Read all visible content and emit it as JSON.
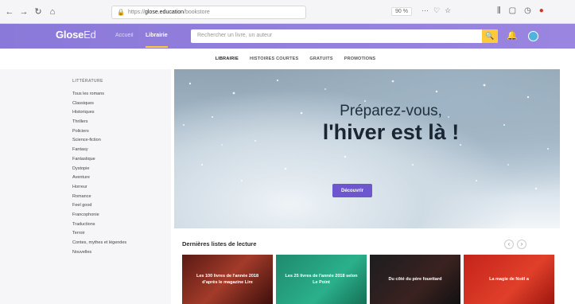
{
  "browser": {
    "nav_icons": [
      "←",
      "→",
      "↻",
      "⌂"
    ],
    "url_prefix": "https://",
    "url_host": "glose.education",
    "url_path": "/bookstore",
    "zoom": "90 %",
    "url_icons": [
      "···",
      "♡",
      "☆"
    ],
    "toolbar_icons": [
      "lib-icon",
      "sidebar-icon",
      "history-icon",
      "record-icon"
    ]
  },
  "header": {
    "logo_main": "Glose",
    "logo_suffix": "Ed",
    "nav_accueil": "Accueil",
    "nav_librairie": "Librairie",
    "search_placeholder": "Rechercher un livre, un auteur",
    "search_icon": "🔍",
    "bell_icon": "🔔"
  },
  "tabs": [
    "LIBRAIRIE",
    "HISTOIRES COURTES",
    "GRATUITS",
    "PROMOTIONS"
  ],
  "sidebar": {
    "title": "LITTÉRATURE",
    "items": [
      "Tous les romans",
      "Classiques",
      "Historiques",
      "Thrillers",
      "Policiers",
      "Science-fiction",
      "Fantasy",
      "Fantastique",
      "Dystopie",
      "Aventure",
      "Horreur",
      "Romance",
      "Feel good",
      "Francophonie",
      "Traductions",
      "Terroir",
      "Contes, mythes et légendes",
      "Nouvelles"
    ]
  },
  "hero": {
    "line1": "Préparez-vous,",
    "line2": "l'hiver est là !",
    "cta": "Découvrir"
  },
  "lists": {
    "title": "Dernières listes de lecture",
    "prev": "‹",
    "next": "›",
    "cards": [
      "Les 100 livres de l'année 2018 d'après le magazine Lire",
      "Les 25 livres de l'année 2018 selon Le Point",
      "Du côté du père fouettard",
      "La magie de Noël a"
    ]
  },
  "colors": {
    "header": "#8b79d9",
    "accent": "#ffc93c",
    "cta": "#6e56cf"
  }
}
